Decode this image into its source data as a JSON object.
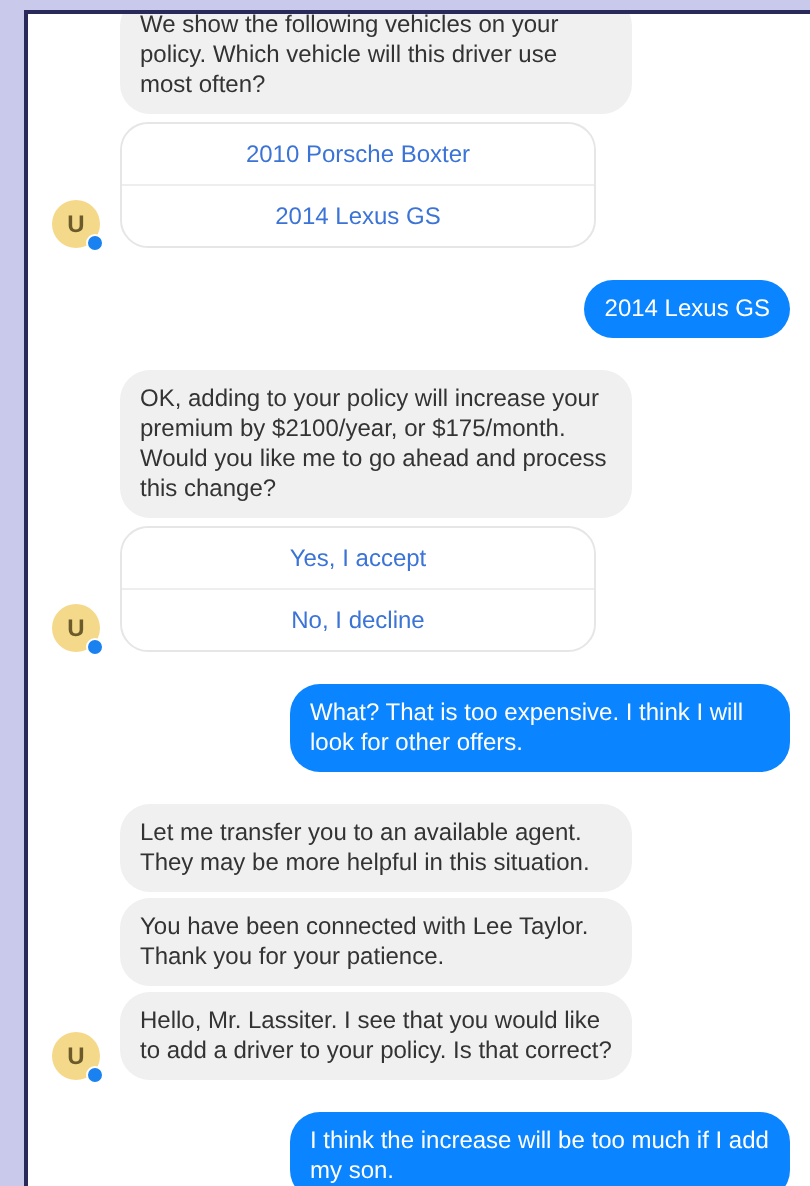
{
  "messages": [
    {
      "kind": "bot",
      "text": "We show the following vehicles on your policy.  Which vehicle will this driver use most often?"
    },
    {
      "kind": "options",
      "options": [
        "2010 Porsche Boxter",
        "2014 Lexus GS"
      ],
      "avatar": "U"
    },
    {
      "kind": "user",
      "text": "2014 Lexus GS"
    },
    {
      "kind": "bot",
      "text": "OK, adding to your policy will increase your premium by $2100/year, or $175/month. Would you like me to go ahead and process this change?"
    },
    {
      "kind": "options",
      "options": [
        "Yes, I accept",
        "No, I decline"
      ],
      "avatar": "U"
    },
    {
      "kind": "user",
      "text": "What? That is too expensive. I think I will look for other offers."
    },
    {
      "kind": "bot",
      "text": "Let me transfer you to an available agent. They may be more helpful in this situation."
    },
    {
      "kind": "bot",
      "text": "You have been connected with Lee Taylor. Thank you for your patience."
    },
    {
      "kind": "bot",
      "text": "Hello, Mr. Lassiter. I see that you would like to add a driver to your policy. Is that correct?",
      "avatar": "U"
    },
    {
      "kind": "user",
      "text": "I think the increase will be too much if I add my son."
    }
  ]
}
